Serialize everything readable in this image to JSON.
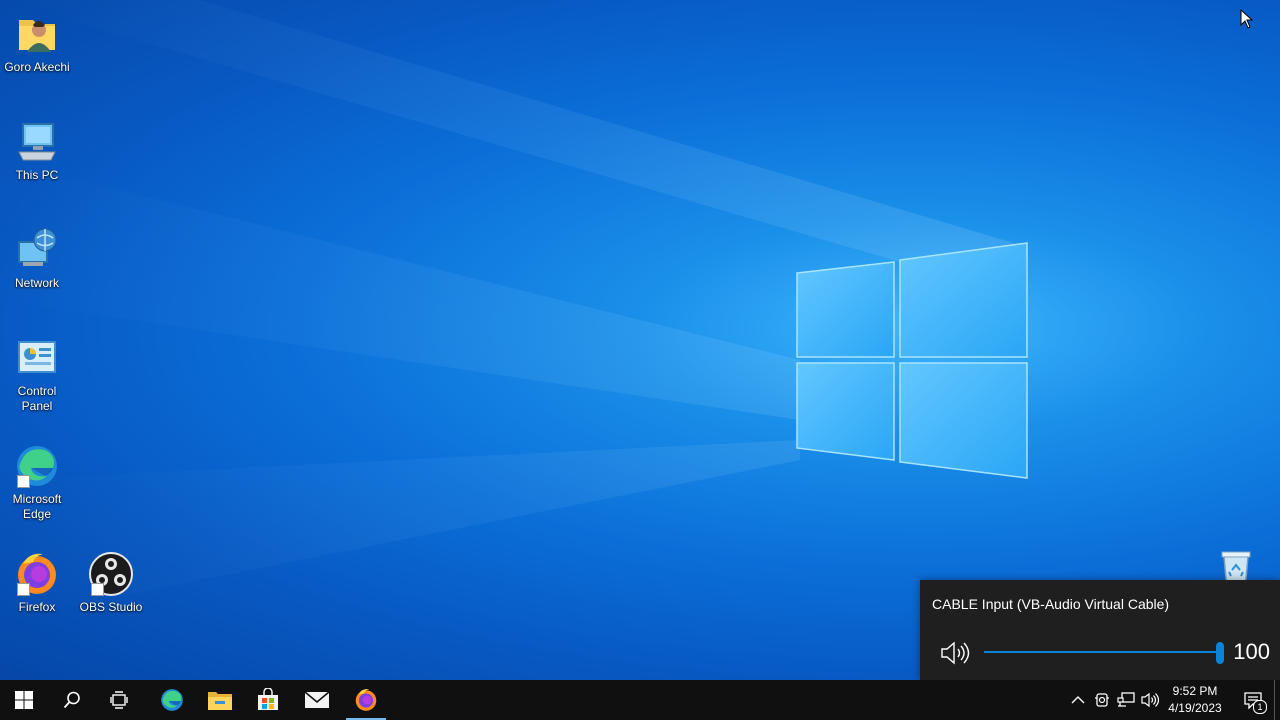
{
  "desktop": {
    "icons": [
      {
        "label": "Goro Akechi",
        "icon": "user-folder-icon"
      },
      {
        "label": "This PC",
        "icon": "computer-icon"
      },
      {
        "label": "Network",
        "icon": "network-icon"
      },
      {
        "label": "Control Panel",
        "icon": "control-panel-icon"
      },
      {
        "label": "Microsoft Edge",
        "icon": "edge-icon"
      },
      {
        "label": "Firefox",
        "icon": "firefox-icon"
      },
      {
        "label": "OBS Studio",
        "icon": "obs-icon"
      },
      {
        "label": "",
        "icon": "recycle-bin-icon"
      }
    ]
  },
  "volume_flyout": {
    "device_name": "CABLE Input (VB-Audio Virtual Cable)",
    "volume_value": "100",
    "volume_level": 1.0,
    "accent_color": "#0a84d8"
  },
  "taskbar": {
    "pinned": [
      {
        "name": "start",
        "icon": "windows-logo-icon"
      },
      {
        "name": "search",
        "icon": "search-icon"
      },
      {
        "name": "task-view",
        "icon": "task-view-icon"
      },
      {
        "name": "edge",
        "icon": "edge-icon"
      },
      {
        "name": "file-explorer",
        "icon": "folder-icon"
      },
      {
        "name": "store",
        "icon": "store-icon"
      },
      {
        "name": "mail",
        "icon": "mail-icon"
      },
      {
        "name": "firefox",
        "icon": "firefox-icon",
        "active": true
      }
    ],
    "tray": {
      "time": "9:52 PM",
      "date": "4/19/2023",
      "notification_count": "1"
    }
  }
}
